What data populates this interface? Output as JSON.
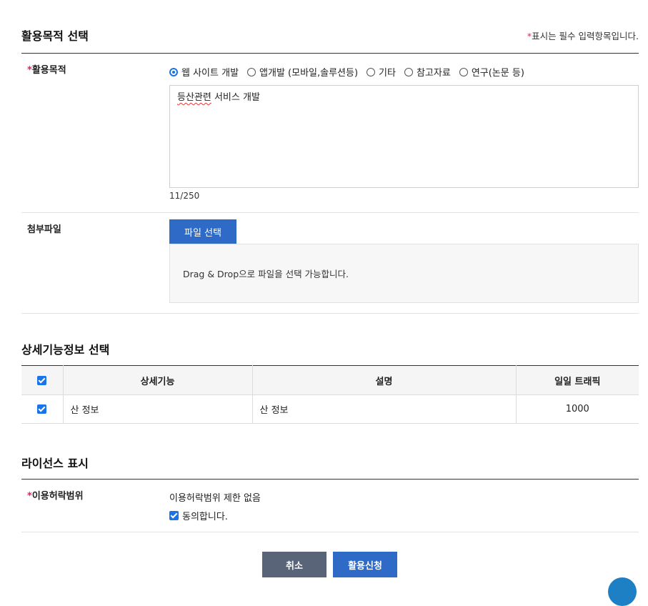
{
  "purpose_section": {
    "title": "활용목적 선택",
    "required_note_star": "*",
    "required_note": "표시는 필수 입력항목입니다."
  },
  "purpose_field": {
    "star": "*",
    "label": "활용목적",
    "options": [
      {
        "label": "웹 사이트 개발",
        "selected": true
      },
      {
        "label": "앱개발 (모바일,솔루션등)",
        "selected": false
      },
      {
        "label": "기타",
        "selected": false
      },
      {
        "label": "참고자료",
        "selected": false
      },
      {
        "label": "연구(논문 등)",
        "selected": false
      }
    ],
    "text_squiggly": "등산관련",
    "text_rest": " 서비스 개발",
    "char_count": "11/250"
  },
  "attachment": {
    "label": "첨부파일",
    "button_label": "파일 선택",
    "dropzone_text": "Drag & Drop으로 파일을 선택 가능합니다."
  },
  "features_section": {
    "title": "상세기능정보 선택",
    "columns": [
      "상세기능",
      "설명",
      "일일 트래픽"
    ],
    "rows": [
      {
        "checked": true,
        "feature": "산 정보",
        "description": "산 정보",
        "traffic": "1000"
      }
    ]
  },
  "license_section": {
    "title": "라이선스 표시",
    "star": "*",
    "label": "이용허락범위",
    "value": "이용허락범위 제한 없음",
    "agree_label": "동의합니다."
  },
  "actions": {
    "cancel_label": "취소",
    "apply_label": "활용신청"
  },
  "colors": {
    "accent": "#2f6ac6",
    "cancel": "#5a6478",
    "required": "#e0245e"
  }
}
